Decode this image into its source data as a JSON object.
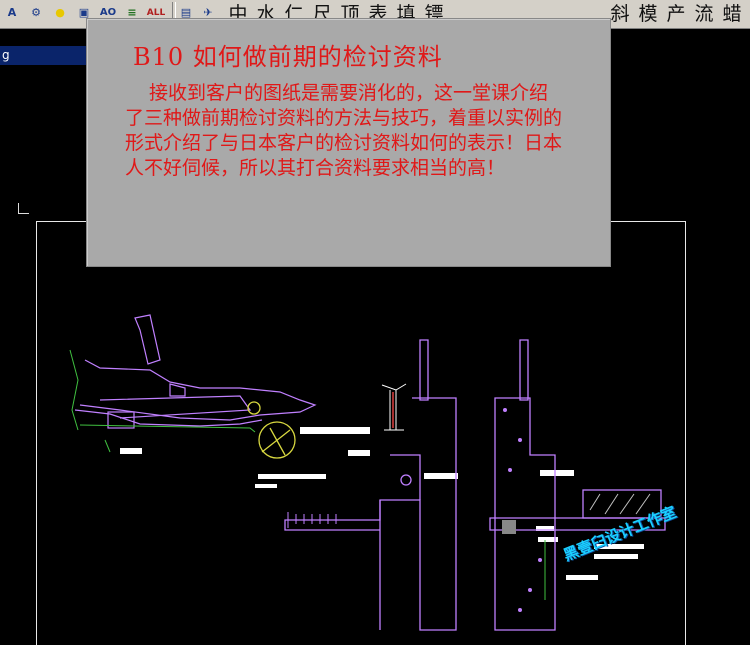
{
  "toolbar": {
    "icons": [
      "text-a-icon",
      "gear-icon",
      "circle-icon",
      "image-icon",
      "text-ao-icon",
      "layers-icon",
      "all-text-icon"
    ],
    "icon_glyphs": [
      "A",
      "⚙",
      "●",
      "▣",
      "AO",
      "≡",
      "ALL"
    ],
    "cjk_buttons": [
      "中",
      "水",
      "仁",
      "尺",
      "顶",
      "表",
      "填",
      "镖",
      "斜",
      "模",
      "产",
      "流",
      "蜡"
    ]
  },
  "window": {
    "title_fragment": "g"
  },
  "popup": {
    "title": "B10  如何做前期的检讨资料",
    "body": "接收到客户的图纸是需要消化的，这一堂课介绍了三种做前期检讨资料的方法与技巧，着重以实例的形式介绍了与日本客户的检讨资料如何的表示！日本人不好伺候，所以其打合资料要求相当的高！"
  },
  "watermark": {
    "text": "黑壹臼设计工作室"
  },
  "colors": {
    "popup_bg": "#a9a9a9",
    "popup_text": "#e01818",
    "canvas_bg": "#000000",
    "cad_purple": "#c080ff",
    "cad_white": "#ffffff",
    "cad_green": "#40c040",
    "cad_yellow": "#d8d840",
    "watermark": "#1ad0ff"
  }
}
